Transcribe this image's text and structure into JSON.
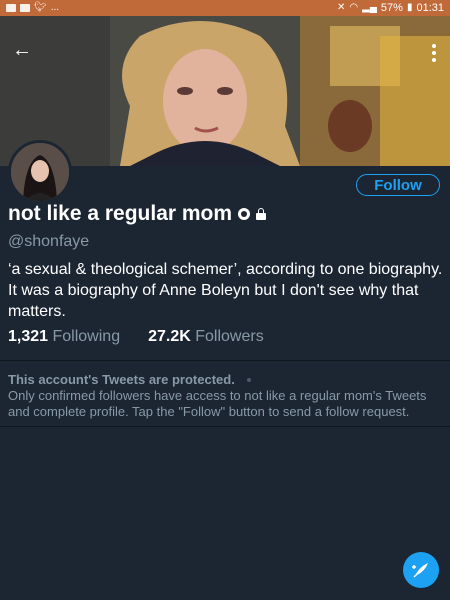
{
  "status_bar": {
    "left_indicator": "...",
    "battery": "57%",
    "time": "01:31"
  },
  "profile": {
    "name": "not like a regular mom",
    "handle": "@shonfaye",
    "bio": "‘a sexual & theological schemer’, according to one biography. It was a biography of Anne Boleyn but I don't see why that matters.",
    "follow_label": "Follow",
    "following": {
      "count": "1,321",
      "label": "Following"
    },
    "followers": {
      "count": "27.2K",
      "label": "Followers"
    }
  },
  "protected": {
    "title": "This account's Tweets are protected.",
    "message": "Only confirmed followers have access to not like a regular mom's Tweets and complete profile. Tap the \"Follow\" button to send a follow request."
  },
  "icons": {
    "back": "back-arrow-icon",
    "menu": "more-vertical-icon",
    "compose": "compose-tweet-icon",
    "verified": "badge-icon",
    "lock": "lock-icon"
  },
  "colors": {
    "background": "#1c2633",
    "accent": "#1da1f2",
    "muted_text": "#8899a6",
    "status_bar": "#c06a3a"
  }
}
